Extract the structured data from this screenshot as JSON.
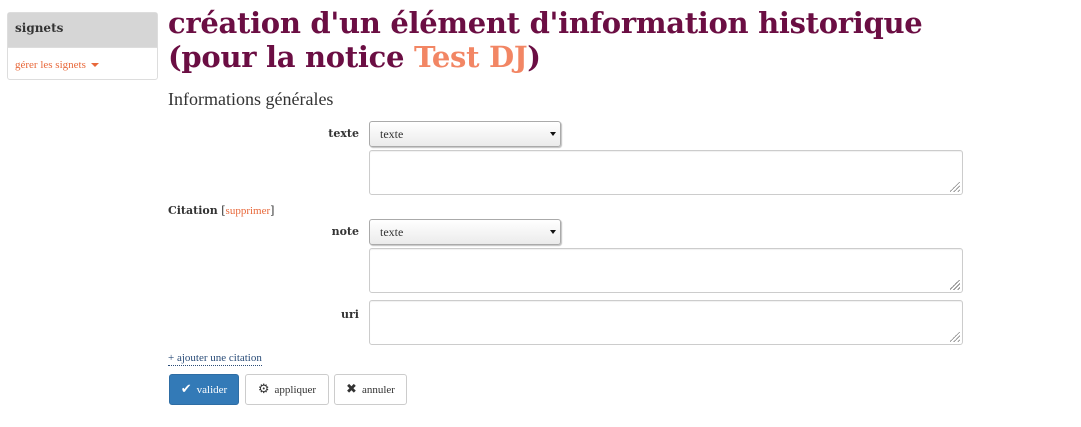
{
  "sidebar": {
    "header": "signets",
    "manage_link": "gérer les signets"
  },
  "title": {
    "prefix": "création d'un élément d'information historique (pour la notice ",
    "notice": "Test DJ",
    "suffix": ")"
  },
  "section": {
    "title": "Informations générales"
  },
  "form": {
    "texte": {
      "label": "texte",
      "format": "texte",
      "value": ""
    },
    "citation": {
      "label": "Citation",
      "delete_open": "[",
      "delete": "supprimer",
      "delete_close": "]"
    },
    "note": {
      "label": "note",
      "format": "texte",
      "value": ""
    },
    "uri": {
      "label": "uri",
      "value": ""
    },
    "add_citation": "+ ajouter une citation"
  },
  "buttons": {
    "validate": {
      "label": "valider",
      "icon": "check-icon"
    },
    "apply": {
      "label": "appliquer",
      "icon": "gear-icon"
    },
    "cancel": {
      "label": "annuler",
      "icon": "close-icon"
    }
  },
  "colors": {
    "title": "#6b0e43",
    "link": "#e8683a",
    "notice_link": "#f28664",
    "primary_button": "#337ab7"
  }
}
